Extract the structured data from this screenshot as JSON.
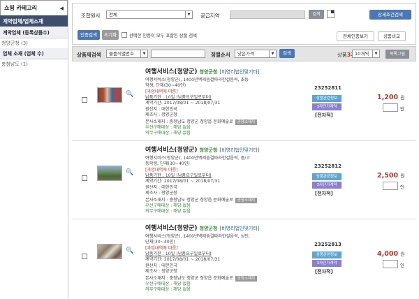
{
  "sidebar": {
    "title": "쇼핑 카테고리",
    "collapse_glyph": "◀",
    "section": "계약업체/업체소재",
    "sub1": "계약업체 (등록상품수)",
    "item1": "청양군청 (3)",
    "sub2": "업체 소재 (업체 수)",
    "item2": "충청남도 (1)"
  },
  "search": {
    "org_label": "조합원사",
    "org_value": "전체",
    "region_label": "공급지역",
    "search_btn": "검색",
    "detail_btn": "상세조건검색",
    "cert_btn": "인증검색",
    "reset_btn": "초기화",
    "check_label": "선택한 인증이 모두 포함된 상품 검색",
    "all_cert_btn": "전체인증보기",
    "compare_btn": "상품비교"
  },
  "filter": {
    "reSearch_label": "상품재검색",
    "reSearch_select": "물품식별번호",
    "sort_label": "정렬순서",
    "sort_select": "낮은가격",
    "sort_btn": "검색",
    "count_label": "상품",
    "count_value": "3",
    "count_unit": "개",
    "per_page": "10개씩",
    "list_btn": "목록그림"
  },
  "products": [
    {
      "title": "여행서비스(청양군)",
      "category": "청양군청",
      "label": "[비영리법인및기타]",
      "desc1": "여행서비스(청양군), 1400년백제숨결따라한걸음씩, 초등",
      "desc2": "학생, 단체(30~40인)",
      "note": "[과업내역에 따름]",
      "delivery": "납품기한 : 10일 (납품요구일로부터)",
      "period": "계약기간: 2017/08/01 ~ 2018/07/31",
      "origin": "원산지 : 대한민국",
      "maker": "제조사 : 청양군청",
      "address": "본사소재지 : 충청남도 청양군 청양읍 문화예술로",
      "addr_tag": "공장소재지",
      "pref1": "우선구매대상 : 해당 없음",
      "pref2": "의무구매대상 : 해당 없음",
      "code": "23252811",
      "btn_a": "상품관련정보",
      "btn_b": "3자단가계약",
      "doc": "[전자적]",
      "price": "1,200",
      "price_unit": "원",
      "qty_unit": "인"
    },
    {
      "title": "여행서비스(청양군)",
      "category": "청양군청",
      "label": "[비영리법인및기타]",
      "desc1": "여행서비스(청양군), 1400년백제숨결따라한걸음씩, 중/고",
      "desc2": "등학생, 단체(30~40인)",
      "note": "[과업내역에 따름]",
      "delivery": "납품기한 : 10일 (납품요구일로부터)",
      "period": "계약기간: 2017/08/01 ~ 2018/07/31",
      "origin": "원산지 : 대한민국",
      "maker": "제조사 : 청양군청",
      "address": "본사소재지 : 충청남도 청양군 청양읍 문화예술로",
      "addr_tag": "공장소재지",
      "pref1": "우선구매대상 : 해당 없음",
      "pref2": "의무구매대상 : 해당 없음",
      "code": "23252812",
      "btn_a": "상품관련정보",
      "btn_b": "3자단가계약",
      "doc": "[전자적]",
      "price": "2,500",
      "price_unit": "원",
      "qty_unit": "인"
    },
    {
      "title": "여행서비스(청양군)",
      "category": "청양군청",
      "label": "[비영리법인및기타]",
      "desc1": "여행서비스(청양군), 1400년백제숨결따라한걸음씩, 성인,",
      "desc2": "단체(30~40인)",
      "note": "[과업내역에 따름]",
      "delivery": "납품기한 : 10일 (납품요구일로부터)",
      "period": "계약기간: 2017/08/01 ~ 2018/07/31",
      "origin": "원산지 : 대한민국",
      "maker": "제조사 : 청양군청",
      "address": "본사소재지 : 충청남도 청양군 청양읍 문화예술로",
      "addr_tag": "공장소재지",
      "pref1": "우선구매대상 : 해당 없음",
      "pref2": "의무구매대상 : 해당 없음",
      "code": "23252813",
      "btn_a": "상품관련정보",
      "btn_b": "3자단가계약",
      "doc": "[전자적]",
      "price": "4,000",
      "price_unit": "원",
      "qty_unit": "인"
    }
  ],
  "icons": {
    "magnifier": "🔍",
    "dropdown": "▼"
  }
}
